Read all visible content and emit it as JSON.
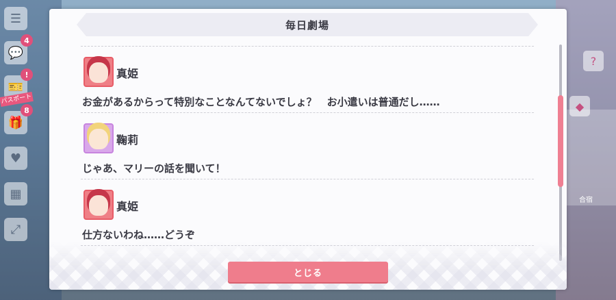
{
  "background": {
    "left_menu": [
      {
        "icon": "menu-icon",
        "glyph": "☰",
        "badge": ""
      },
      {
        "icon": "chat-icon",
        "glyph": "💬",
        "badge": "4"
      },
      {
        "icon": "pass-icon",
        "glyph": "🎫",
        "badge": "!"
      },
      {
        "icon": "gift-icon",
        "glyph": "🎁",
        "badge": "8"
      },
      {
        "icon": "heart-icon",
        "glyph": "♥",
        "badge": ""
      },
      {
        "icon": "card-icon",
        "glyph": "▦",
        "badge": ""
      },
      {
        "icon": "expand-icon",
        "glyph": "⤢",
        "badge": ""
      }
    ],
    "pass_label": "パスポート",
    "right_label": "合宿"
  },
  "dialog": {
    "title": "毎日劇場",
    "entries": [
      {
        "speaker": "真姫",
        "character": "maki",
        "text": "お金があるからって特別なことなんてないでしょ？　お小遣いは普通だし……"
      },
      {
        "speaker": "鞠莉",
        "character": "mari",
        "text": "じゃあ、マリーの話を聞いて！"
      },
      {
        "speaker": "真姫",
        "character": "maki",
        "text": "仕方ないわね……どうぞ"
      }
    ],
    "close_label": "とじる"
  },
  "colors": {
    "accent": "#ef7d8c",
    "text": "#3a3a44",
    "scroll_thumb": "#ef7f92"
  }
}
